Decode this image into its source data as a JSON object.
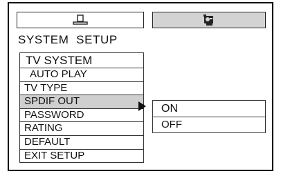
{
  "tabs": [
    {
      "icon": "monitor-icon"
    },
    {
      "icon": "dvd-player-icon"
    }
  ],
  "title": "SYSTEM  SETUP",
  "menu": {
    "items": [
      {
        "label": "TV SYSTEM"
      },
      {
        "label": "AUTO PLAY"
      },
      {
        "label": "TV TYPE"
      },
      {
        "label": "SPDIF OUT"
      },
      {
        "label": "PASSWORD"
      },
      {
        "label": "RATING"
      },
      {
        "label": "DEFAULT"
      },
      {
        "label": "EXIT SETUP"
      }
    ],
    "selected_index": 3
  },
  "submenu": {
    "options": [
      {
        "label": "ON"
      },
      {
        "label": "OFF"
      }
    ]
  },
  "colors": {
    "highlight": "#cfcfcf",
    "active_tab": "#d3d3d3",
    "border": "#111111"
  }
}
